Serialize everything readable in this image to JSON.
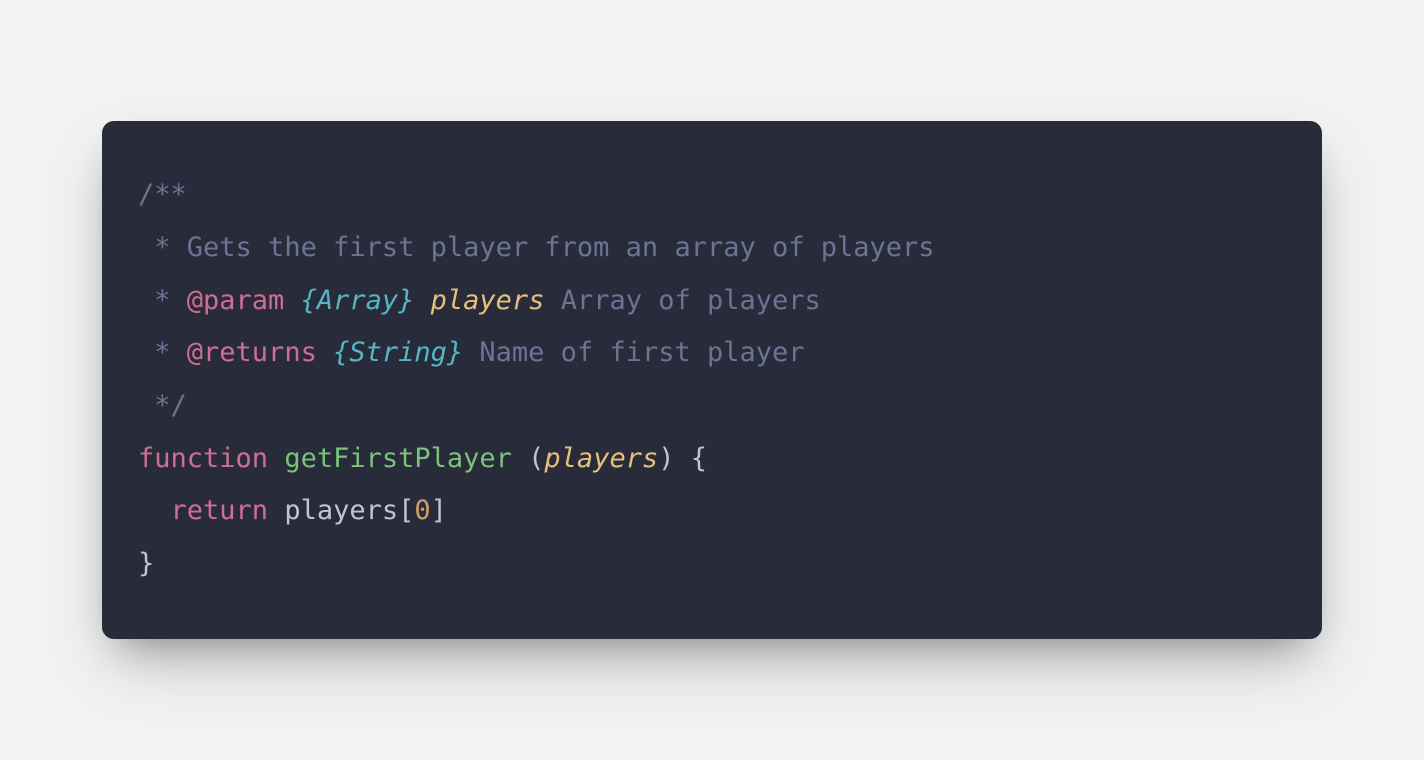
{
  "code": {
    "line1": "/**",
    "line2_prefix": " * ",
    "line2_text": "Gets the first player from an array of players",
    "line3_prefix": " * ",
    "line3_tag": "@param",
    "line3_space1": " ",
    "line3_type": "{Array}",
    "line3_space2": " ",
    "line3_param": "players",
    "line3_space3": " ",
    "line3_desc": "Array of players",
    "line4_prefix": " * ",
    "line4_tag": "@returns",
    "line4_space1": " ",
    "line4_type": "{String}",
    "line4_space2": " ",
    "line4_desc": "Name of first player",
    "line5": " */",
    "line6_keyword": "function",
    "line6_space1": " ",
    "line6_fname": "getFirstPlayer",
    "line6_space2": " ",
    "line6_paren_open": "(",
    "line6_param": "players",
    "line6_paren_close": ")",
    "line6_space3": " ",
    "line6_brace": "{",
    "line7_indent": "  ",
    "line7_keyword": "return",
    "line7_space": " ",
    "line7_ident": "players",
    "line7_bracket_open": "[",
    "line7_index": "0",
    "line7_bracket_close": "]",
    "line8": "}"
  },
  "colors": {
    "background": "#f2f2f2",
    "code_bg": "#282c3a",
    "comment": "#6c7393",
    "jsdoc_tag": "#d16d92",
    "jsdoc_type": "#56b6c2",
    "jsdoc_param": "#e5c07b",
    "keyword": "#d16d92",
    "function": "#7bc379",
    "number": "#d19a66",
    "text": "#c0c5ce"
  }
}
